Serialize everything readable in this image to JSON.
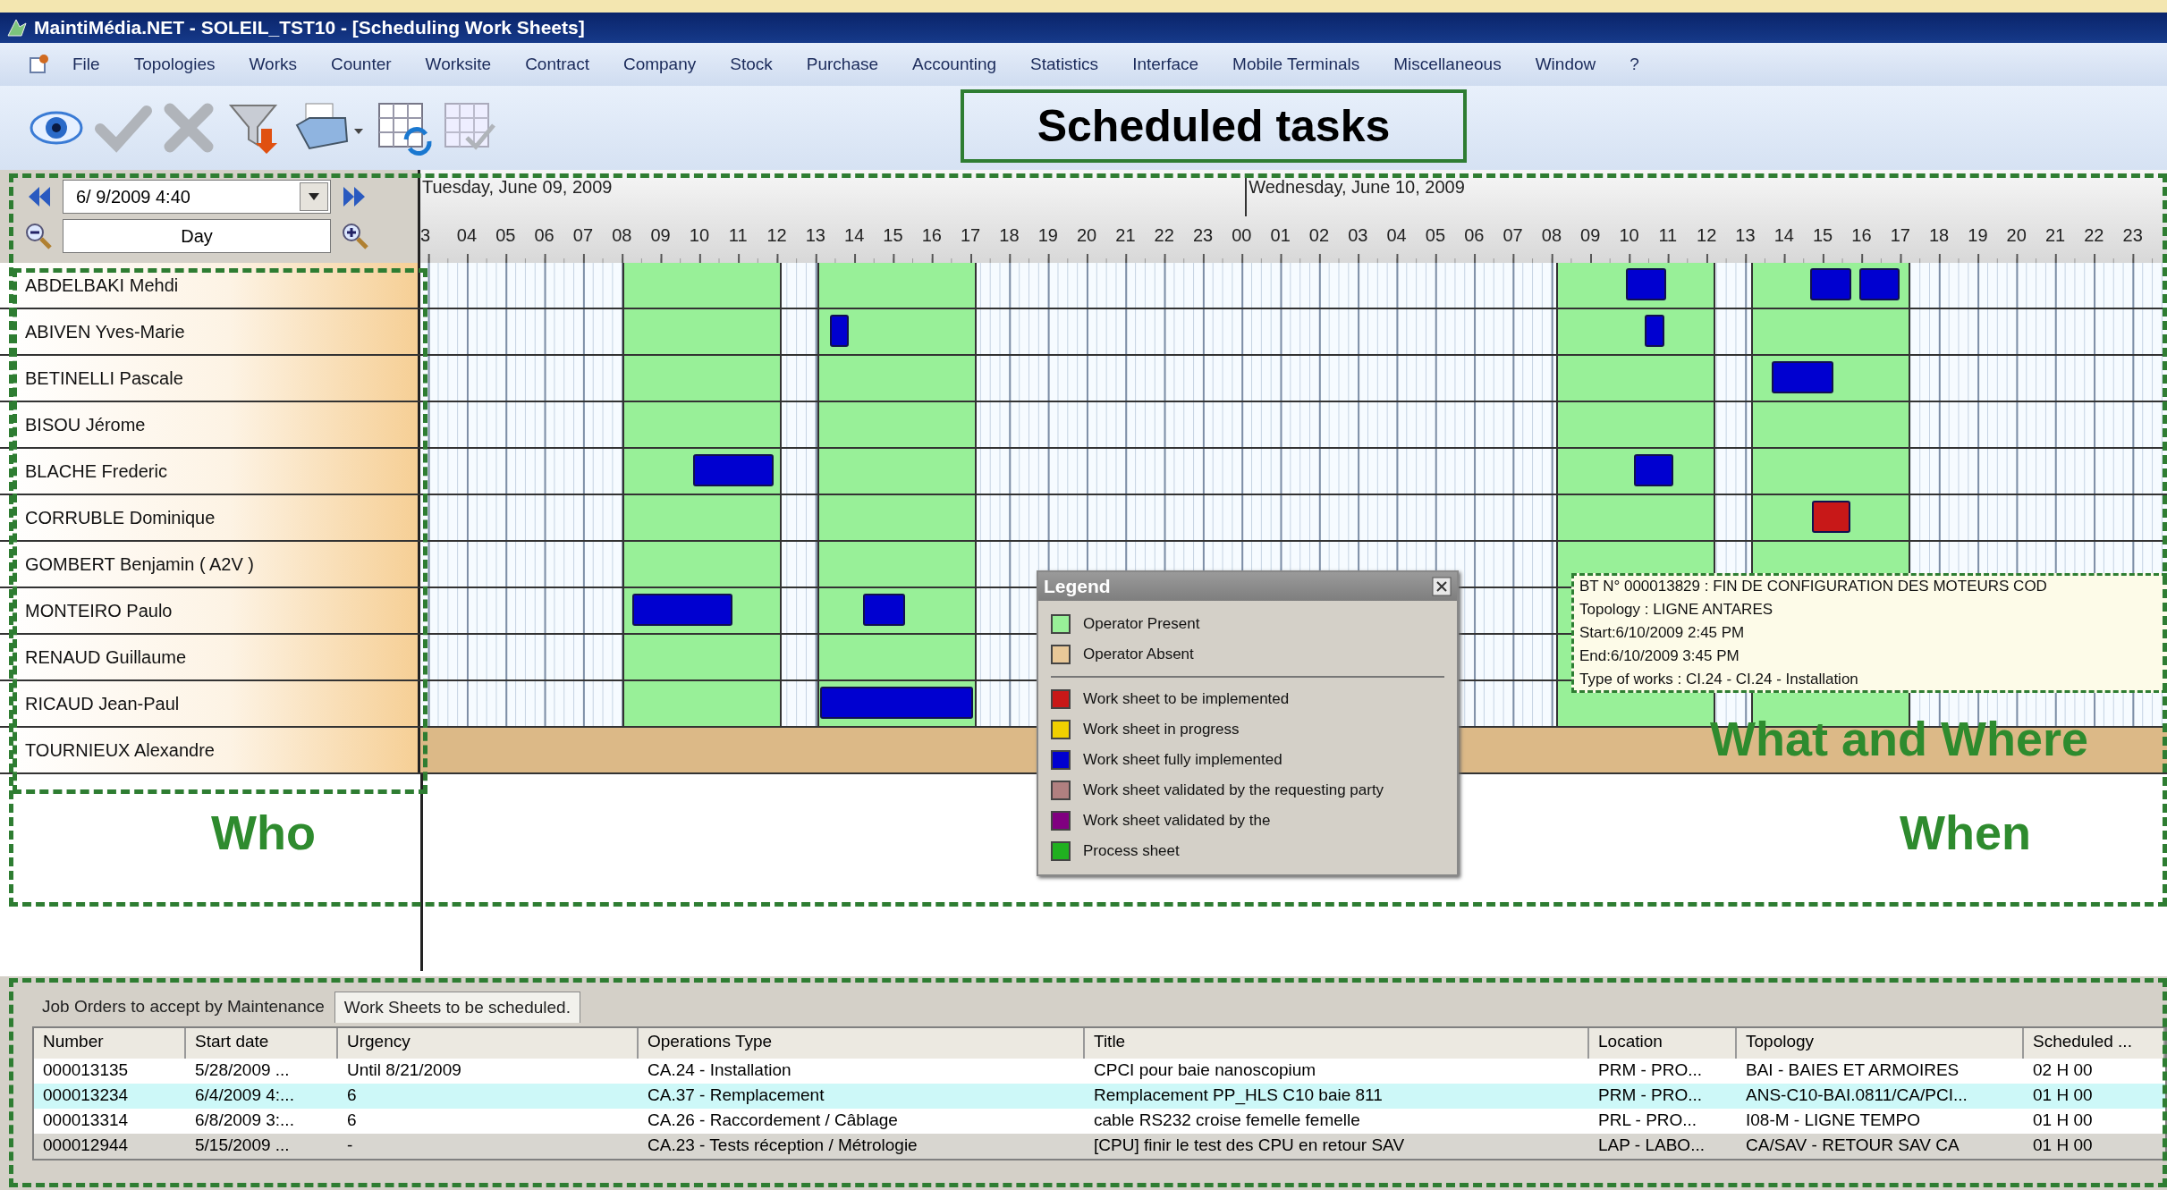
{
  "window": {
    "title": "MaintiMédia.NET - SOLEIL_TST10 - [Scheduling Work Sheets]"
  },
  "menu": [
    "File",
    "Topologies",
    "Works",
    "Counter",
    "Worksite",
    "Contract",
    "Company",
    "Stock",
    "Purchase",
    "Accounting",
    "Statistics",
    "Interface",
    "Mobile Terminals",
    "Miscellaneous",
    "Window",
    "?"
  ],
  "toolbar": [
    {
      "kind": "eye",
      "disabled": false
    },
    {
      "kind": "check",
      "disabled": true
    },
    {
      "kind": "cross",
      "disabled": true
    },
    {
      "kind": "filter",
      "disabled": false
    },
    {
      "kind": "print",
      "disabled": false
    },
    {
      "kind": "grid-refresh",
      "disabled": false
    },
    {
      "kind": "grid-check",
      "disabled": true
    }
  ],
  "annotations": {
    "title": "Scheduled tasks",
    "who": "Who",
    "when": "When",
    "what": "What and Where"
  },
  "scheduler": {
    "date_field": "6/ 9/2009  4:40",
    "view": "Day",
    "days": [
      {
        "label": "Tuesday, June 09, 2009"
      },
      {
        "label": "Wednesday, June 10, 2009"
      }
    ],
    "hours": [
      "3",
      "04",
      "05",
      "06",
      "07",
      "08",
      "09",
      "10",
      "11",
      "12",
      "13",
      "14",
      "15",
      "16",
      "17",
      "18",
      "19",
      "20",
      "21",
      "22",
      "23",
      "00",
      "01",
      "02",
      "03",
      "04",
      "05",
      "06",
      "07",
      "08",
      "09",
      "10",
      "11",
      "12",
      "13",
      "14",
      "15",
      "16",
      "17",
      "18",
      "19",
      "20",
      "21",
      "22",
      "23"
    ],
    "resources": [
      {
        "name": "ABDELBAKI Mehdi",
        "present": true,
        "tasks": [
          {
            "color": "#0000d0"
          },
          {
            "color": "#0000d0"
          },
          {
            "color": "#0000d0"
          }
        ]
      },
      {
        "name": "ABIVEN Yves-Marie",
        "present": true,
        "tasks": [
          {
            "color": "#0000d0"
          },
          {
            "color": "#0000d0"
          }
        ]
      },
      {
        "name": "BETINELLI Pascale",
        "present": true,
        "tasks": [
          {
            "color": "#0000d0"
          }
        ]
      },
      {
        "name": "BISOU Jérome",
        "present": true
      },
      {
        "name": "BLACHE Frederic",
        "present": true,
        "tasks": [
          {
            "color": "#0000d0"
          },
          {
            "color": "#0000d0"
          }
        ]
      },
      {
        "name": "CORRUBLE Dominique",
        "present": true,
        "tasks": [
          {
            "color": "#c81818"
          }
        ]
      },
      {
        "name": "GOMBERT Benjamin ( A2V )",
        "present": true
      },
      {
        "name": "MONTEIRO Paulo",
        "present": true,
        "tasks": [
          {
            "color": "#0000d0"
          },
          {
            "color": "#0000d0"
          }
        ]
      },
      {
        "name": "RENAUD Guillaume",
        "present": true
      },
      {
        "name": "RICAUD Jean-Paul",
        "present": true,
        "tasks": [
          {
            "color": "#0000d0"
          }
        ]
      },
      {
        "name": "TOURNIEUX Alexandre",
        "present": false
      }
    ]
  },
  "legend": {
    "title": "Legend",
    "items": [
      {
        "label": "Operator Present",
        "color": "#98f098",
        "divider": false
      },
      {
        "label": "Operator Absent",
        "color": "#e8c898",
        "divider": true
      },
      {
        "label": "Work sheet to be implemented",
        "color": "#c81818",
        "divider": false
      },
      {
        "label": "Work sheet in progress",
        "color": "#f0d000",
        "divider": false
      },
      {
        "label": "Work sheet fully implemented",
        "color": "#0000d0",
        "divider": false
      },
      {
        "label": "Work sheet validated by the requesting party",
        "color": "#b08080",
        "divider": false
      },
      {
        "label": "Work sheet validated by the",
        "color": "#800080",
        "divider": false
      },
      {
        "label": "Process sheet",
        "color": "#20b020",
        "divider": false
      }
    ]
  },
  "tooltip": {
    "lines": [
      "BT N° 000013829 : FIN DE CONFIGURATION DES MOTEURS COD",
      "Topology : LIGNE ANTARES",
      "Start:6/10/2009 2:45 PM",
      "End:6/10/2009 3:45 PM",
      "Type of works : CI.24 - CI.24 - Installation"
    ]
  },
  "bottom": {
    "tabs": [
      {
        "label": "Job Orders to accept by Maintenance",
        "selected": false
      },
      {
        "label": "Work Sheets to be scheduled.",
        "selected": true
      }
    ],
    "columns": [
      "Number",
      "Start date",
      "Urgency",
      "Operations Type",
      "Title",
      "Location",
      "Topology",
      "Scheduled ..."
    ],
    "rows": [
      {
        "selected": false,
        "highlighted": false,
        "cells": [
          "000013135",
          "5/28/2009 ...",
          "Until 8/21/2009",
          "CA.24 - Installation",
          "CPCI pour baie nanoscopium",
          "PRM - PRO...",
          "BAI - BAIES ET ARMOIRES",
          "02 H 00"
        ]
      },
      {
        "selected": true,
        "highlighted": false,
        "cells": [
          "000013234",
          "6/4/2009 4:...",
          "6",
          "CA.37 - Remplacement",
          "Remplacement PP_HLS C10 baie 811",
          "PRM - PRO...",
          "ANS-C10-BAI.0811/CA/PCI...",
          "01 H 00"
        ]
      },
      {
        "selected": false,
        "highlighted": false,
        "cells": [
          "000013314",
          "6/8/2009 3:...",
          "6",
          "CA.26 - Raccordement / Câblage",
          "cable RS232 croise femelle femelle",
          "PRL - PRO...",
          "I08-M - LIGNE TEMPO",
          "01 H 00"
        ]
      },
      {
        "selected": false,
        "highlighted": true,
        "cells": [
          "000012944",
          "5/15/2009 ...",
          "-",
          "CA.23 - Tests réception / Métrologie",
          "[CPU] finir le test des CPU en retour SAV",
          "LAP - LABO...",
          "CA/SAV - RETOUR SAV CA",
          "01 H 00"
        ]
      }
    ]
  }
}
